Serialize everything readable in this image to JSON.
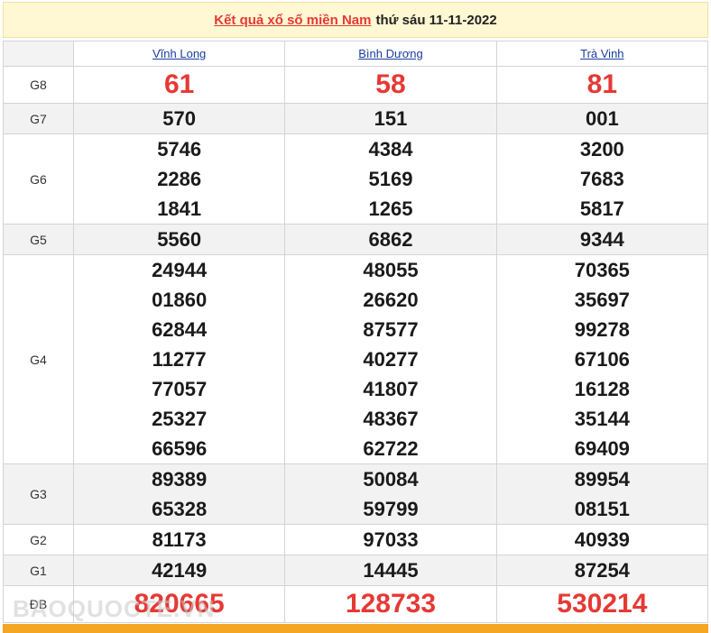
{
  "header": {
    "title_link": "Kết quả xổ số miền Nam",
    "date_text": "thứ sáu 11-11-2022"
  },
  "provinces": [
    "Vĩnh Long",
    "Bình Dương",
    "Trà Vinh"
  ],
  "prizes": [
    {
      "label": "G8",
      "values": [
        [
          "61"
        ],
        [
          "58"
        ],
        [
          "81"
        ]
      ]
    },
    {
      "label": "G7",
      "values": [
        [
          "570"
        ],
        [
          "151"
        ],
        [
          "001"
        ]
      ]
    },
    {
      "label": "G6",
      "values": [
        [
          "5746",
          "2286",
          "1841"
        ],
        [
          "4384",
          "5169",
          "1265"
        ],
        [
          "3200",
          "7683",
          "5817"
        ]
      ]
    },
    {
      "label": "G5",
      "values": [
        [
          "5560"
        ],
        [
          "6862"
        ],
        [
          "9344"
        ]
      ]
    },
    {
      "label": "G4",
      "values": [
        [
          "24944",
          "01860",
          "62844",
          "11277",
          "77057",
          "25327",
          "66596"
        ],
        [
          "48055",
          "26620",
          "87577",
          "40277",
          "41807",
          "48367",
          "62722"
        ],
        [
          "70365",
          "35697",
          "99278",
          "67106",
          "16128",
          "35144",
          "69409"
        ]
      ]
    },
    {
      "label": "G3",
      "values": [
        [
          "89389",
          "65328"
        ],
        [
          "50084",
          "59799"
        ],
        [
          "89954",
          "08151"
        ]
      ]
    },
    {
      "label": "G2",
      "values": [
        [
          "81173"
        ],
        [
          "97033"
        ],
        [
          "40939"
        ]
      ]
    },
    {
      "label": "G1",
      "values": [
        [
          "42149"
        ],
        [
          "14445"
        ],
        [
          "87254"
        ]
      ]
    },
    {
      "label": "ĐB",
      "values": [
        [
          "820665"
        ],
        [
          "128733"
        ],
        [
          "530214"
        ]
      ]
    }
  ],
  "watermark": "BAOQUOCTE.VN",
  "colors": {
    "accent_red": "#e53935",
    "link_blue": "#1a3d9e",
    "header_bg": "#fff8d2"
  }
}
